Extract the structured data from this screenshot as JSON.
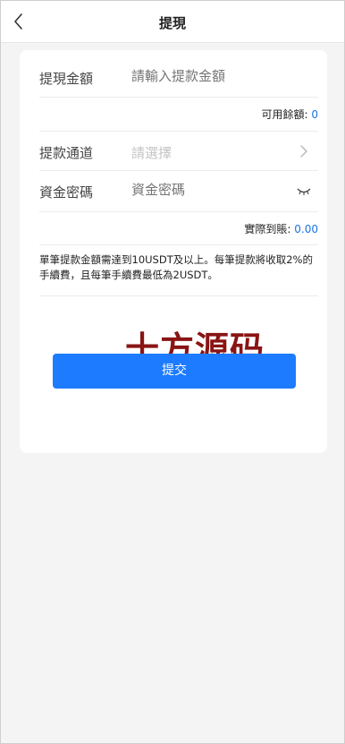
{
  "header": {
    "title": "提現"
  },
  "form": {
    "amount": {
      "label": "提現金額",
      "placeholder": "請輸入提款金額"
    },
    "balance": {
      "label": "可用餘額:",
      "value": "0"
    },
    "channel": {
      "label": "提款通道",
      "placeholder": "請選擇"
    },
    "password": {
      "label": "資金密碼",
      "placeholder": "資金密碼"
    },
    "received": {
      "label": "實際到賬:",
      "value": "0.00"
    }
  },
  "notice": "單筆提款金額需達到10USDT及以上。每筆提款將收取2%的手續費，且每筆手續費最低為2USDT。",
  "watermark": "十方源码",
  "submit_label": "提交",
  "icons": {
    "back": "chevron-left-icon",
    "channel": "chevron-right-icon",
    "password_toggle": "eye-closed-icon"
  },
  "colors": {
    "accent": "#1d7bff",
    "link_value": "#1a73e8",
    "watermark": "#8a1414"
  }
}
